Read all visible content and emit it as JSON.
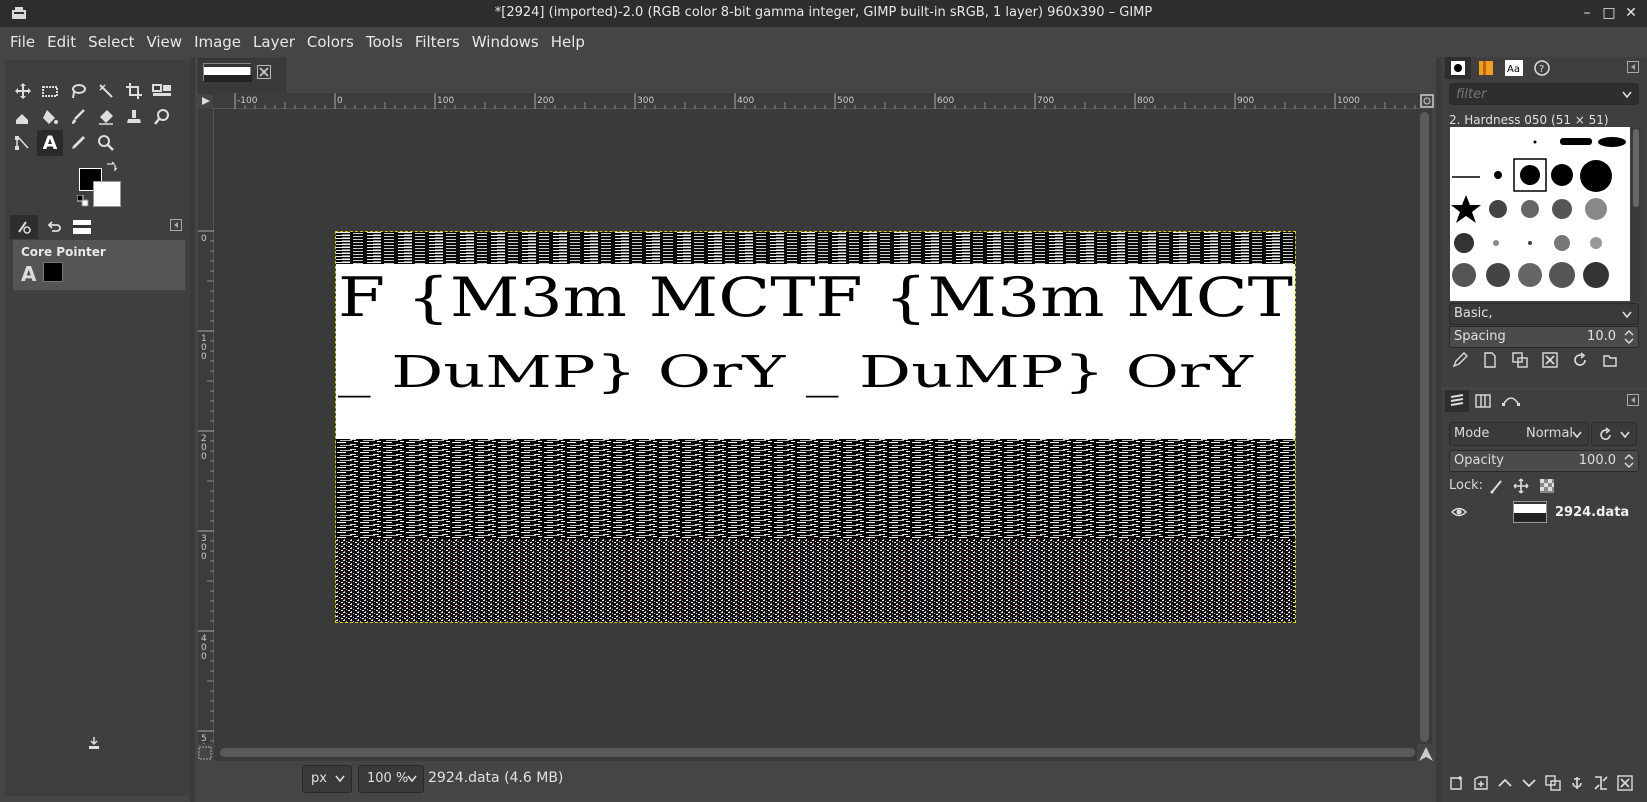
{
  "window": {
    "title": "*[2924] (imported)-2.0 (RGB color 8-bit gamma integer, GIMP built-in sRGB, 1 layer) 960x390 – GIMP",
    "minimize": "–",
    "maximize": "□",
    "close": "✕"
  },
  "menu": [
    "File",
    "Edit",
    "Select",
    "View",
    "Image",
    "Layer",
    "Colors",
    "Tools",
    "Filters",
    "Windows",
    "Help"
  ],
  "tool_options": {
    "title": "Core Pointer",
    "glyph": "A"
  },
  "rulers": {
    "h_ticks": [
      "-100",
      "0",
      "100",
      "200",
      "300",
      "400",
      "500",
      "600",
      "700",
      "800",
      "900",
      "1000"
    ],
    "v_ticks": [
      "0",
      "100",
      "200",
      "300",
      "400",
      "500"
    ]
  },
  "image": {
    "text_line1": "F {M3m MCTF {M3m MCT",
    "text_line2": "_ DuMP}   OrY _ DuMP}   OrY"
  },
  "statusbar": {
    "unit": "px",
    "zoom": "100 %",
    "info": "2924.data (4.6 MB)"
  },
  "brushes": {
    "filter_placeholder": "filter",
    "selected_brush": "2. Hardness 050 (51 × 51)",
    "preset": "Basic,",
    "spacing_label": "Spacing",
    "spacing_value": "10.0"
  },
  "layers": {
    "mode_label": "Mode",
    "mode_value": "Normal",
    "opacity_label": "Opacity",
    "opacity_value": "100.0",
    "lock_label": "Lock:",
    "items": [
      {
        "name": "2924.data",
        "visible": true
      }
    ]
  }
}
